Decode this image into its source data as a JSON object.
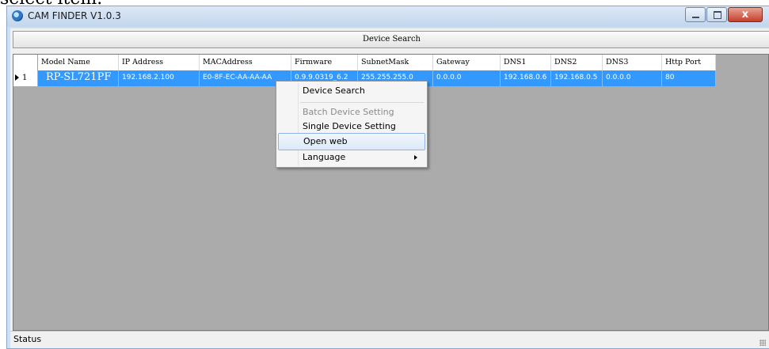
{
  "top_caption": "select item.",
  "window": {
    "title": "CAM FINDER V1.0.3",
    "close_glyph": "x"
  },
  "toolbar": {
    "device_search_label": "Device Search"
  },
  "table": {
    "columns": [
      "Model Name",
      "IP Address",
      "MACAddress",
      "Firmware",
      "SubnetMask",
      "Gateway",
      "DNS1",
      "DNS2",
      "DNS3",
      "Http Port"
    ],
    "rows": [
      {
        "index": "1",
        "model_name": "RP-SL721PF",
        "ip_address": "192.168.2.100",
        "mac_address": "E0-8F-EC-AA-AA-AA",
        "firmware": "0.9.9.0319_6.2",
        "subnet_mask": "255.255.255.0",
        "gateway": "0.0.0.0",
        "dns1": "192.168.0.6",
        "dns2": "192.168.0.5",
        "dns3": "0.0.0.0",
        "http_port": "80"
      }
    ]
  },
  "context_menu": {
    "items": [
      {
        "label": "Device Search",
        "enabled": true
      },
      {
        "label": "Batch Device Setting",
        "enabled": false
      },
      {
        "label": "Single Device Setting",
        "enabled": true
      },
      {
        "label": "Open web",
        "enabled": true,
        "highlighted": true
      },
      {
        "label": "Language",
        "enabled": true,
        "has_submenu": true
      }
    ]
  },
  "status": {
    "text": "Status"
  },
  "colors": {
    "selection": "#3399ff",
    "grid_background": "#ababab",
    "title_bar": "#cfe0f3",
    "close_button": "#c4402b"
  },
  "icons": {
    "app": "cam-finder-icon",
    "minimize": "minimize-icon",
    "maximize": "maximize-icon",
    "close": "close-icon",
    "row_pointer": "row-pointer-icon",
    "submenu": "submenu-arrow-icon"
  }
}
